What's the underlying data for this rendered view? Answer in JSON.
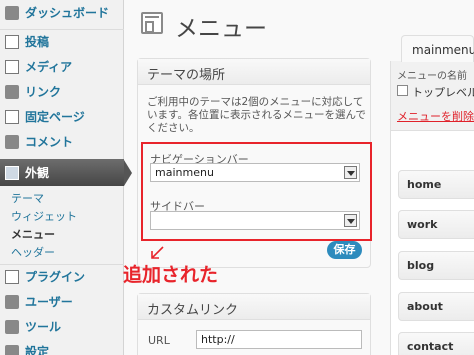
{
  "sidebar": {
    "items": [
      {
        "label": "ダッシュボード"
      },
      {
        "label": "投稿"
      },
      {
        "label": "メディア"
      },
      {
        "label": "リンク"
      },
      {
        "label": "固定ページ"
      },
      {
        "label": "コメント"
      },
      {
        "label": "外観"
      },
      {
        "label": "プラグイン"
      },
      {
        "label": "ユーザー"
      },
      {
        "label": "ツール"
      },
      {
        "label": "設定"
      }
    ],
    "submenu": [
      {
        "label": "テーマ"
      },
      {
        "label": "ウィジェット"
      },
      {
        "label": "メニュー"
      },
      {
        "label": "ヘッダー"
      }
    ]
  },
  "header": {
    "title": "メニュー"
  },
  "theme_locations": {
    "title": "テーマの場所",
    "description": "ご利用中のテーマは2個のメニューに対応しています。各位置に表示されるメニューを選んでください。",
    "navigation_label": "ナビゲーションバー",
    "navigation_value": "mainmenu",
    "sidebar_label": "サイドバー",
    "sidebar_value": "",
    "save_label": "保存"
  },
  "annotation": {
    "text": "追加された"
  },
  "custom_links": {
    "title": "カスタムリンク",
    "url_label": "URL",
    "url_value": "http://"
  },
  "menu_editor": {
    "tab_label": "mainmenu",
    "name_label": "メニューの名前",
    "top_level_label": "トップレベル",
    "delete_label": "メニューを削除",
    "items": [
      {
        "label": "home"
      },
      {
        "label": "work"
      },
      {
        "label": "blog"
      },
      {
        "label": "about"
      },
      {
        "label": "contact"
      }
    ]
  },
  "colors": {
    "accent": "#21759b",
    "highlight": "#e8242b",
    "save_button": "#2d8bbd"
  }
}
